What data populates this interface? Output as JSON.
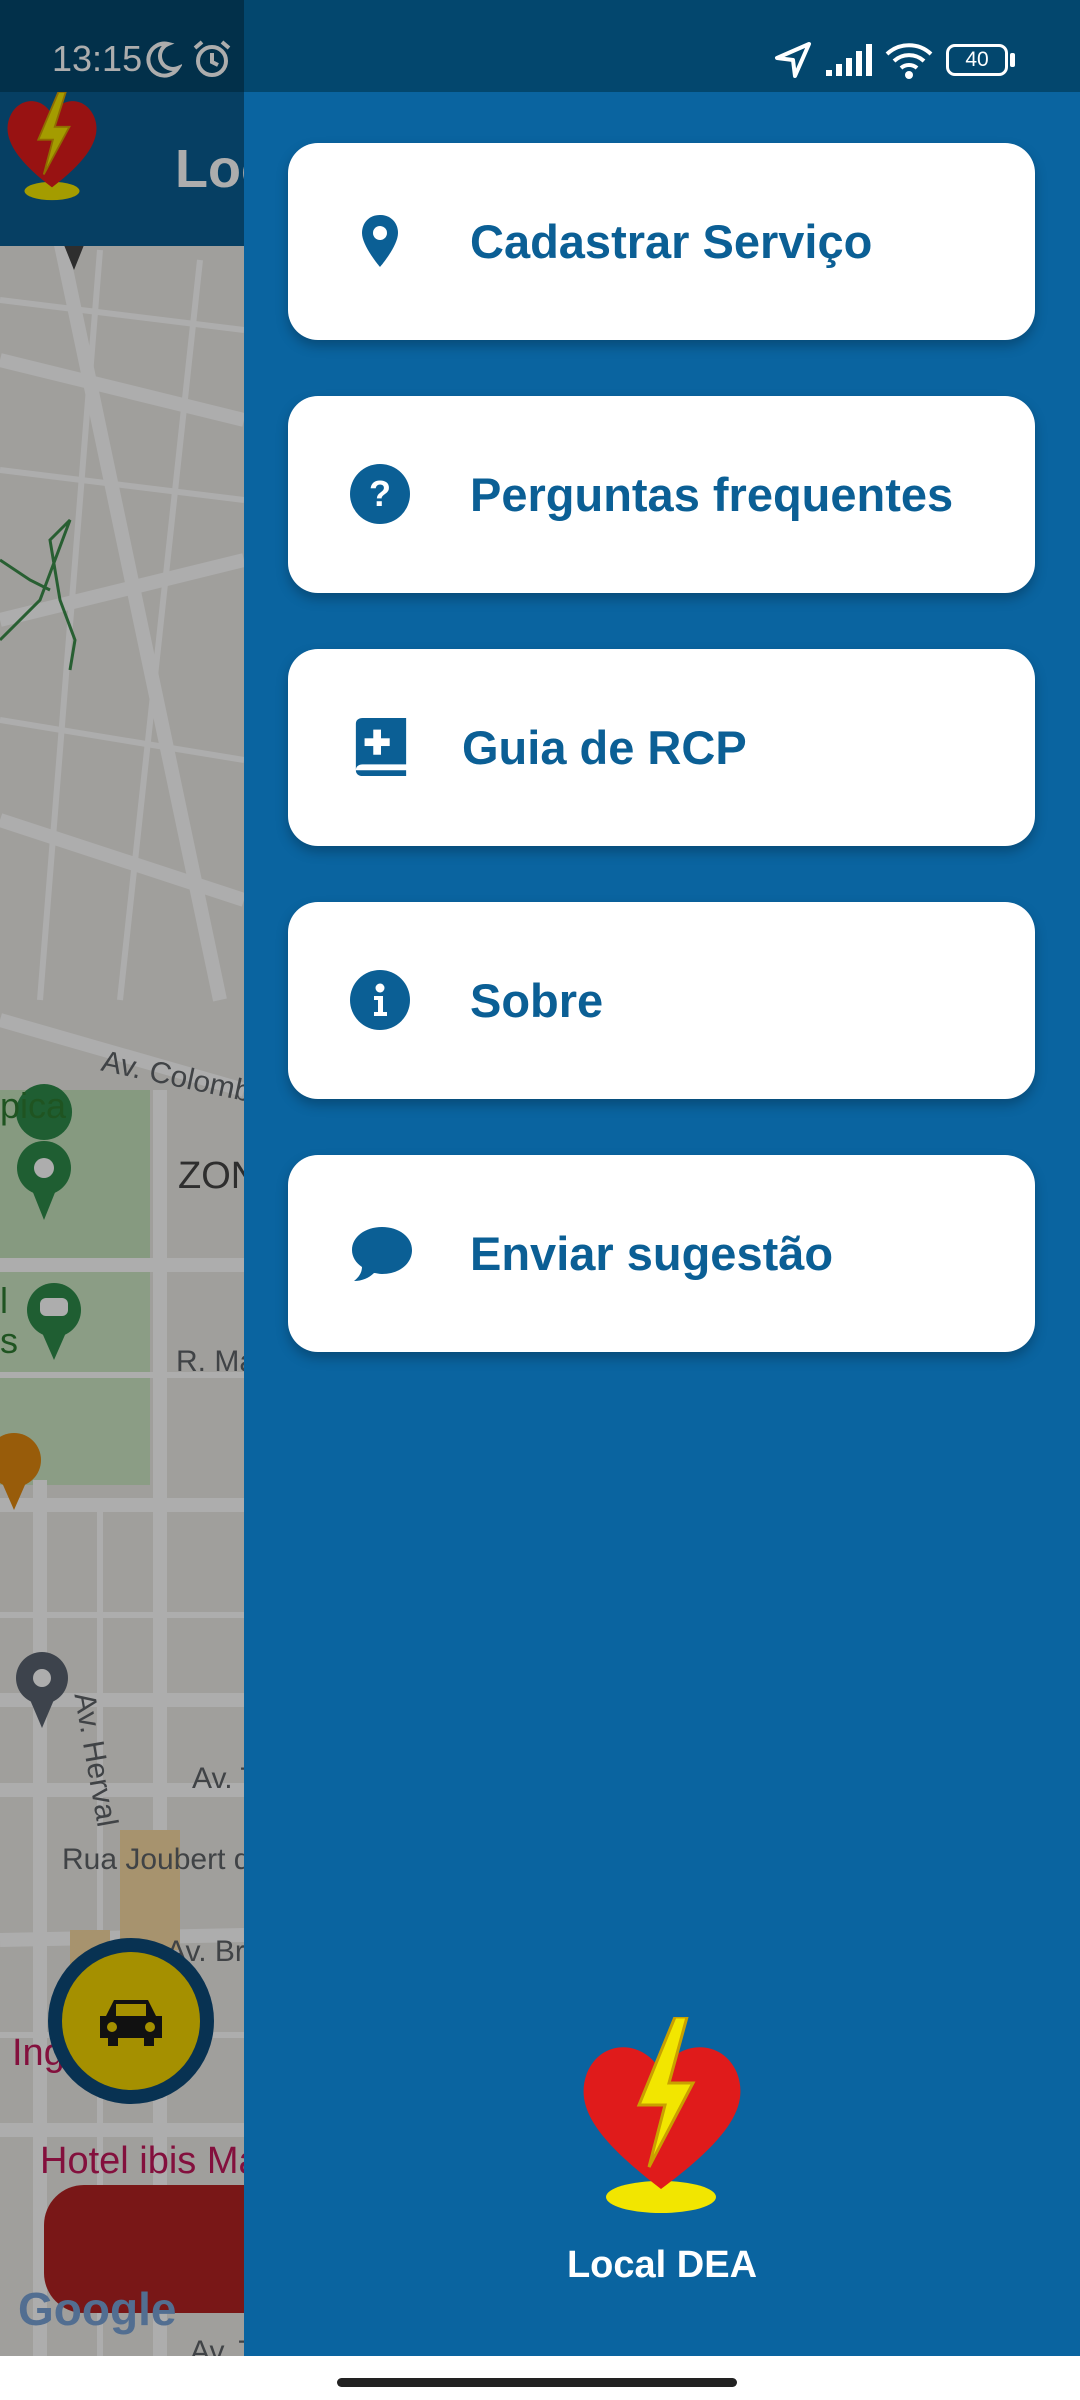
{
  "status_bar": {
    "time": "13:15",
    "battery": "40"
  },
  "app_bar": {
    "title": "Local DEA"
  },
  "map": {
    "labels": [
      "Av. Colombo",
      "ZON",
      "R. Ma",
      "Av. Herval",
      "Av. T",
      "Rua Joubert de",
      "Av. Bra",
      "Inga",
      "Hotel ibis Ma",
      "Av. T",
      "pica",
      "l",
      "s"
    ],
    "google_logo": "Google"
  },
  "drawer": {
    "items": [
      {
        "label": "Cadastrar Serviço",
        "icon": "location-pin-icon"
      },
      {
        "label": "Perguntas frequentes",
        "icon": "help-circle-icon"
      },
      {
        "label": "Guia de RCP",
        "icon": "medical-book-icon"
      },
      {
        "label": "Sobre",
        "icon": "info-icon"
      },
      {
        "label": "Enviar sugestão",
        "icon": "chat-bubble-icon"
      }
    ],
    "footer_label": "Local DEA"
  },
  "colors": {
    "drawer_bg": "#0a64a0",
    "item_text": "#0b5f95",
    "status_bar": "#03476e"
  }
}
